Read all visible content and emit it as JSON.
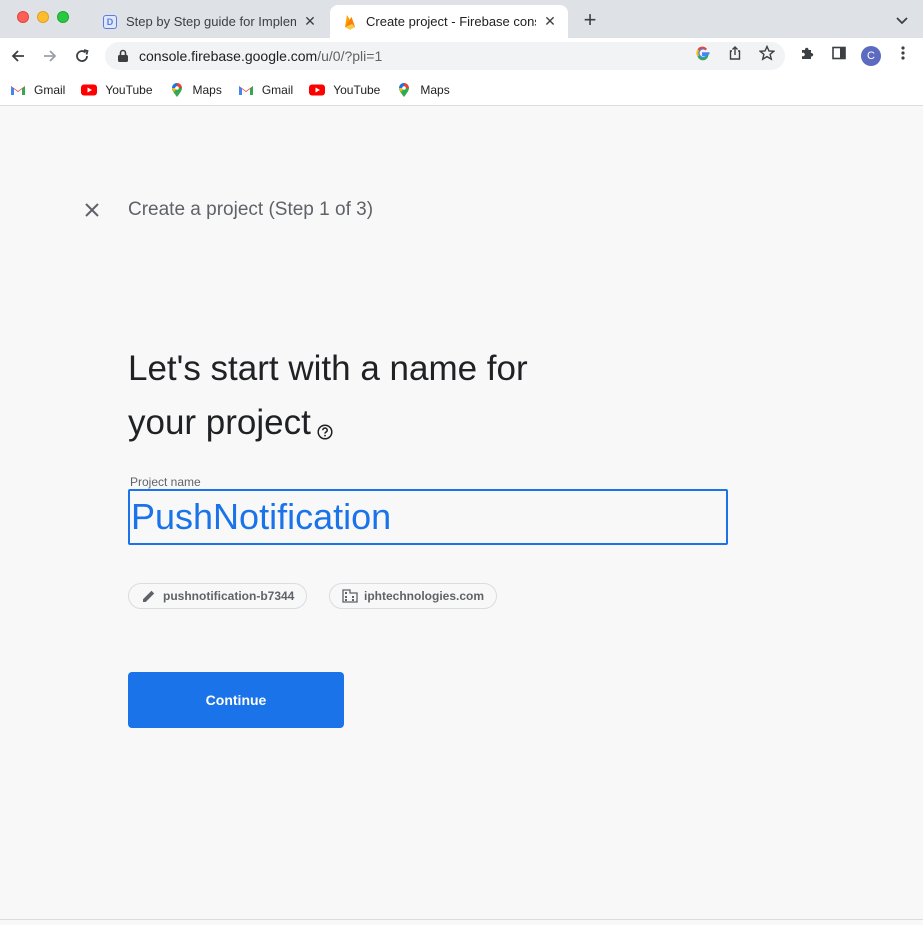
{
  "browser": {
    "tabs": [
      {
        "title": "Step by Step guide for Impleme",
        "favicon": "document-d-icon"
      },
      {
        "title": "Create project - Firebase conso",
        "favicon": "firebase-flame-icon"
      }
    ],
    "url_host": "console.firebase.google.com",
    "url_path": "/u/0/?pli=1",
    "profile_initial": "C"
  },
  "bookmarks": [
    {
      "label": "Gmail",
      "icon": "gmail-icon"
    },
    {
      "label": "YouTube",
      "icon": "youtube-icon"
    },
    {
      "label": "Maps",
      "icon": "maps-icon"
    },
    {
      "label": "Gmail",
      "icon": "gmail-icon"
    },
    {
      "label": "YouTube",
      "icon": "youtube-icon"
    },
    {
      "label": "Maps",
      "icon": "maps-icon"
    }
  ],
  "page": {
    "step_title": "Create a project (Step 1 of 3)",
    "headline": "Let's start with a name for your project",
    "field_label": "Project name",
    "field_value": "PushNotification",
    "chip_project_id": "pushnotification-b7344",
    "chip_org": "iphtechnologies.com",
    "continue_label": "Continue"
  },
  "colors": {
    "accent": "#1a73e8",
    "tab_strip": "#dee1e6",
    "page_bg": "#f8f8f8"
  }
}
